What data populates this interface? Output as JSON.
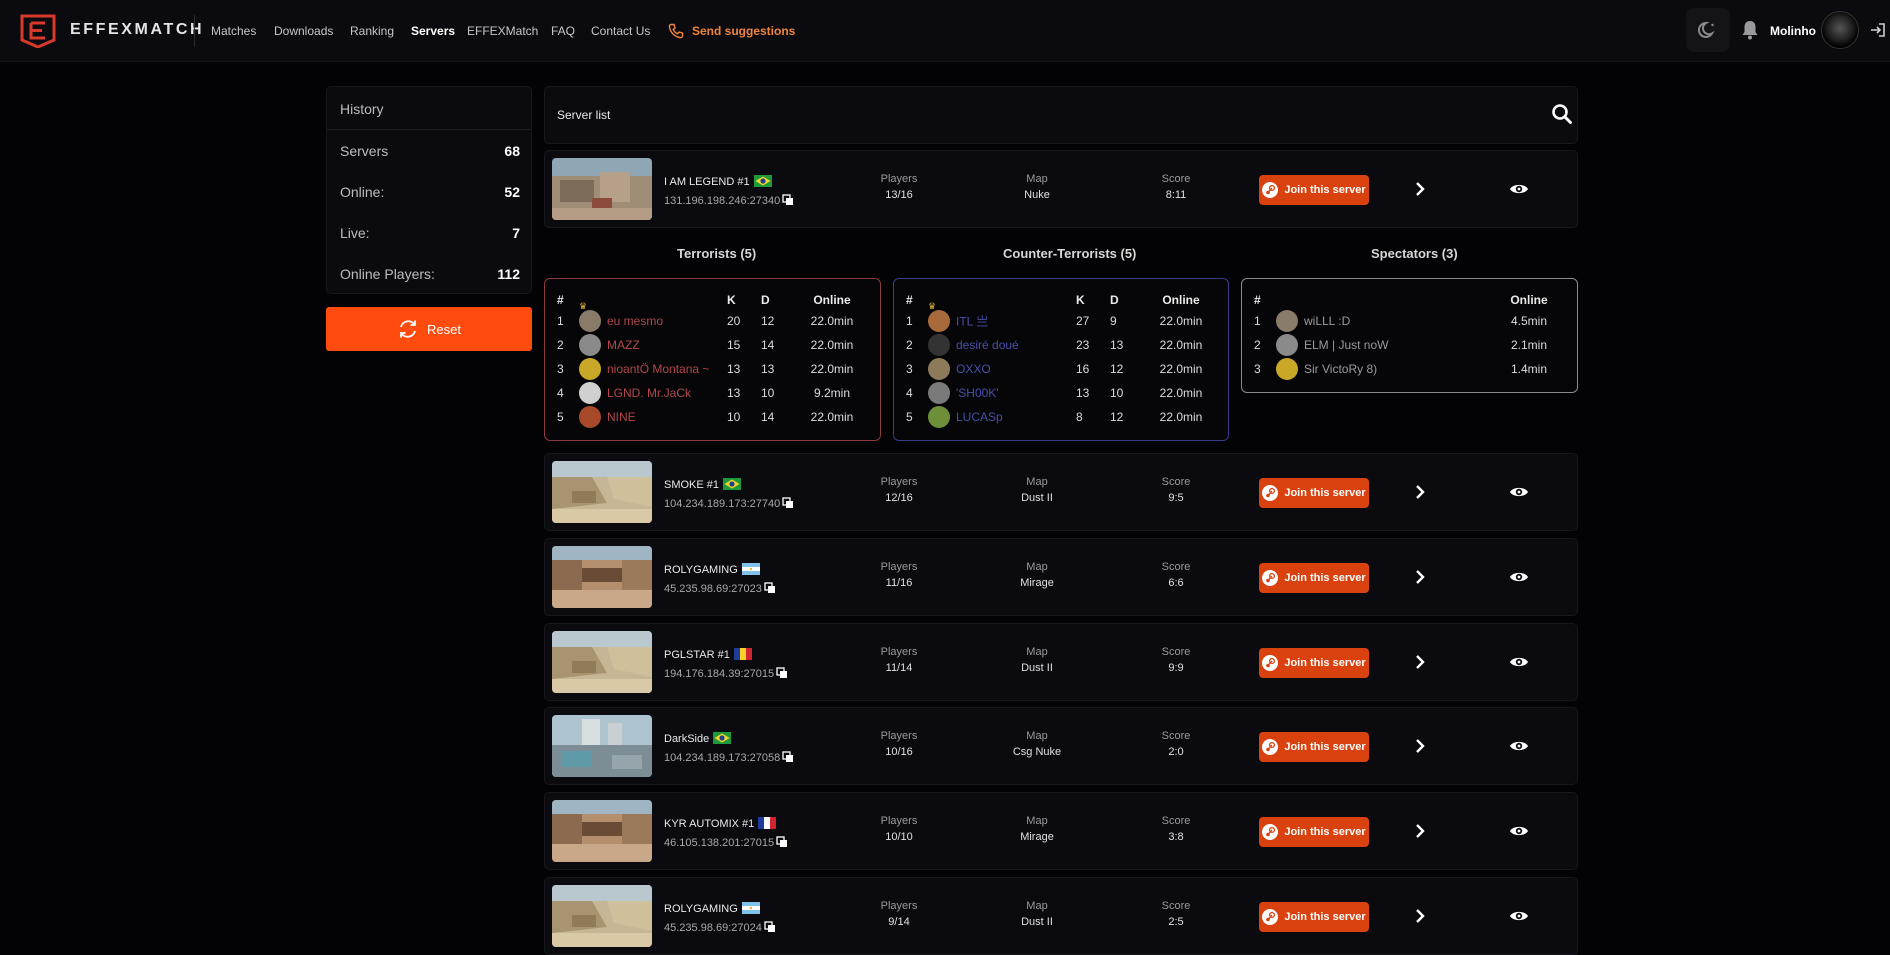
{
  "nav": {
    "brand": "EFFEXMATCH",
    "links": [
      "Matches",
      "Downloads",
      "Ranking",
      "Servers",
      "EFFEXMatch",
      "FAQ",
      "Contact Us"
    ],
    "active": "Servers",
    "send_suggestions": "Send suggestions",
    "username": "Molinho",
    "accent": "#f0843a"
  },
  "history": {
    "title": "History",
    "rows": [
      {
        "label": "Servers",
        "value": "68"
      },
      {
        "label": "Online:",
        "value": "52"
      },
      {
        "label": "Live:",
        "value": "7"
      },
      {
        "label": "Online Players:",
        "value": "112"
      }
    ],
    "reset_label": "Reset",
    "reset_color": "#ff4b0d"
  },
  "search": {
    "placeholder": "Server list"
  },
  "labels": {
    "players": "Players",
    "map": "Map",
    "score": "Score",
    "join": "Join this server"
  },
  "servers": [
    {
      "name": "I AM LEGEND #1",
      "flag": "brazil",
      "ip": "131.196.198.246:27340",
      "players": "13/16",
      "map": "Nuke",
      "score": "8:11",
      "thumb": "nuke"
    },
    {
      "name": "SMOKE #1",
      "flag": "brazil",
      "ip": "104.234.189.173:27740",
      "players": "12/16",
      "map": "Dust II",
      "score": "9:5",
      "thumb": "dust"
    },
    {
      "name": "ROLYGAMING",
      "flag": "argentina",
      "ip": "45.235.98.69:27023",
      "players": "11/16",
      "map": "Mirage",
      "score": "6:6",
      "thumb": "mirage"
    },
    {
      "name": "PGLSTAR #1",
      "flag": "romania",
      "ip": "194.176.184.39:27015",
      "players": "11/14",
      "map": "Dust II",
      "score": "9:9",
      "thumb": "dust"
    },
    {
      "name": "DarkSide",
      "flag": "brazil",
      "ip": "104.234.189.173:27058",
      "players": "10/16",
      "map": "Csg Nuke",
      "score": "2:0",
      "thumb": "csgnuke"
    },
    {
      "name": "KYR AUTOMIX #1",
      "flag": "france",
      "ip": "46.105.138.201:27015",
      "players": "10/10",
      "map": "Mirage",
      "score": "3:8",
      "thumb": "mirage"
    },
    {
      "name": "ROLYGAMING",
      "flag": "argentina",
      "ip": "45.235.98.69:27024",
      "players": "9/14",
      "map": "Dust II",
      "score": "2:5",
      "thumb": "dust"
    }
  ],
  "teams": {
    "terrorists": {
      "title": "Terrorists (5)",
      "color": "#b0474c",
      "headers": [
        "#",
        "",
        "K",
        "D",
        "Online"
      ],
      "players": [
        {
          "n": "1",
          "name": "eu mesmo",
          "k": "20",
          "d": "12",
          "online": "22.0min",
          "crown": true
        },
        {
          "n": "2",
          "name": "MAZZ",
          "k": "15",
          "d": "14",
          "online": "22.0min"
        },
        {
          "n": "3",
          "name": "nioantÖ Montana ~",
          "k": "13",
          "d": "13",
          "online": "22.0min"
        },
        {
          "n": "4",
          "name": "LGND. Mr.JaCk",
          "k": "13",
          "d": "10",
          "online": "9.2min"
        },
        {
          "n": "5",
          "name": "NINE",
          "k": "10",
          "d": "14",
          "online": "22.0min"
        }
      ]
    },
    "ct": {
      "title": "Counter-Terrorists (5)",
      "color": "#4a4fa8",
      "headers": [
        "#",
        "",
        "K",
        "D",
        "Online"
      ],
      "players": [
        {
          "n": "1",
          "name": "ITL 亗",
          "k": "27",
          "d": "9",
          "online": "22.0min",
          "crown": true
        },
        {
          "n": "2",
          "name": "desiré doué",
          "k": "23",
          "d": "13",
          "online": "22.0min"
        },
        {
          "n": "3",
          "name": "OXXO",
          "k": "16",
          "d": "12",
          "online": "22.0min"
        },
        {
          "n": "4",
          "name": "'SH00K'",
          "k": "13",
          "d": "10",
          "online": "22.0min"
        },
        {
          "n": "5",
          "name": "LUCASp",
          "k": "8",
          "d": "12",
          "online": "22.0min"
        }
      ]
    },
    "spectators": {
      "title": "Spectators (3)",
      "color": "#9a9a9a",
      "headers": [
        "#",
        "",
        "Online"
      ],
      "players": [
        {
          "n": "1",
          "name": "wiLLL :D",
          "online": "4.5min"
        },
        {
          "n": "2",
          "name": "ELM | Just noW",
          "online": "2.1min"
        },
        {
          "n": "3",
          "name": "Sir VictoRy 8)",
          "online": "1.4min"
        }
      ]
    }
  }
}
